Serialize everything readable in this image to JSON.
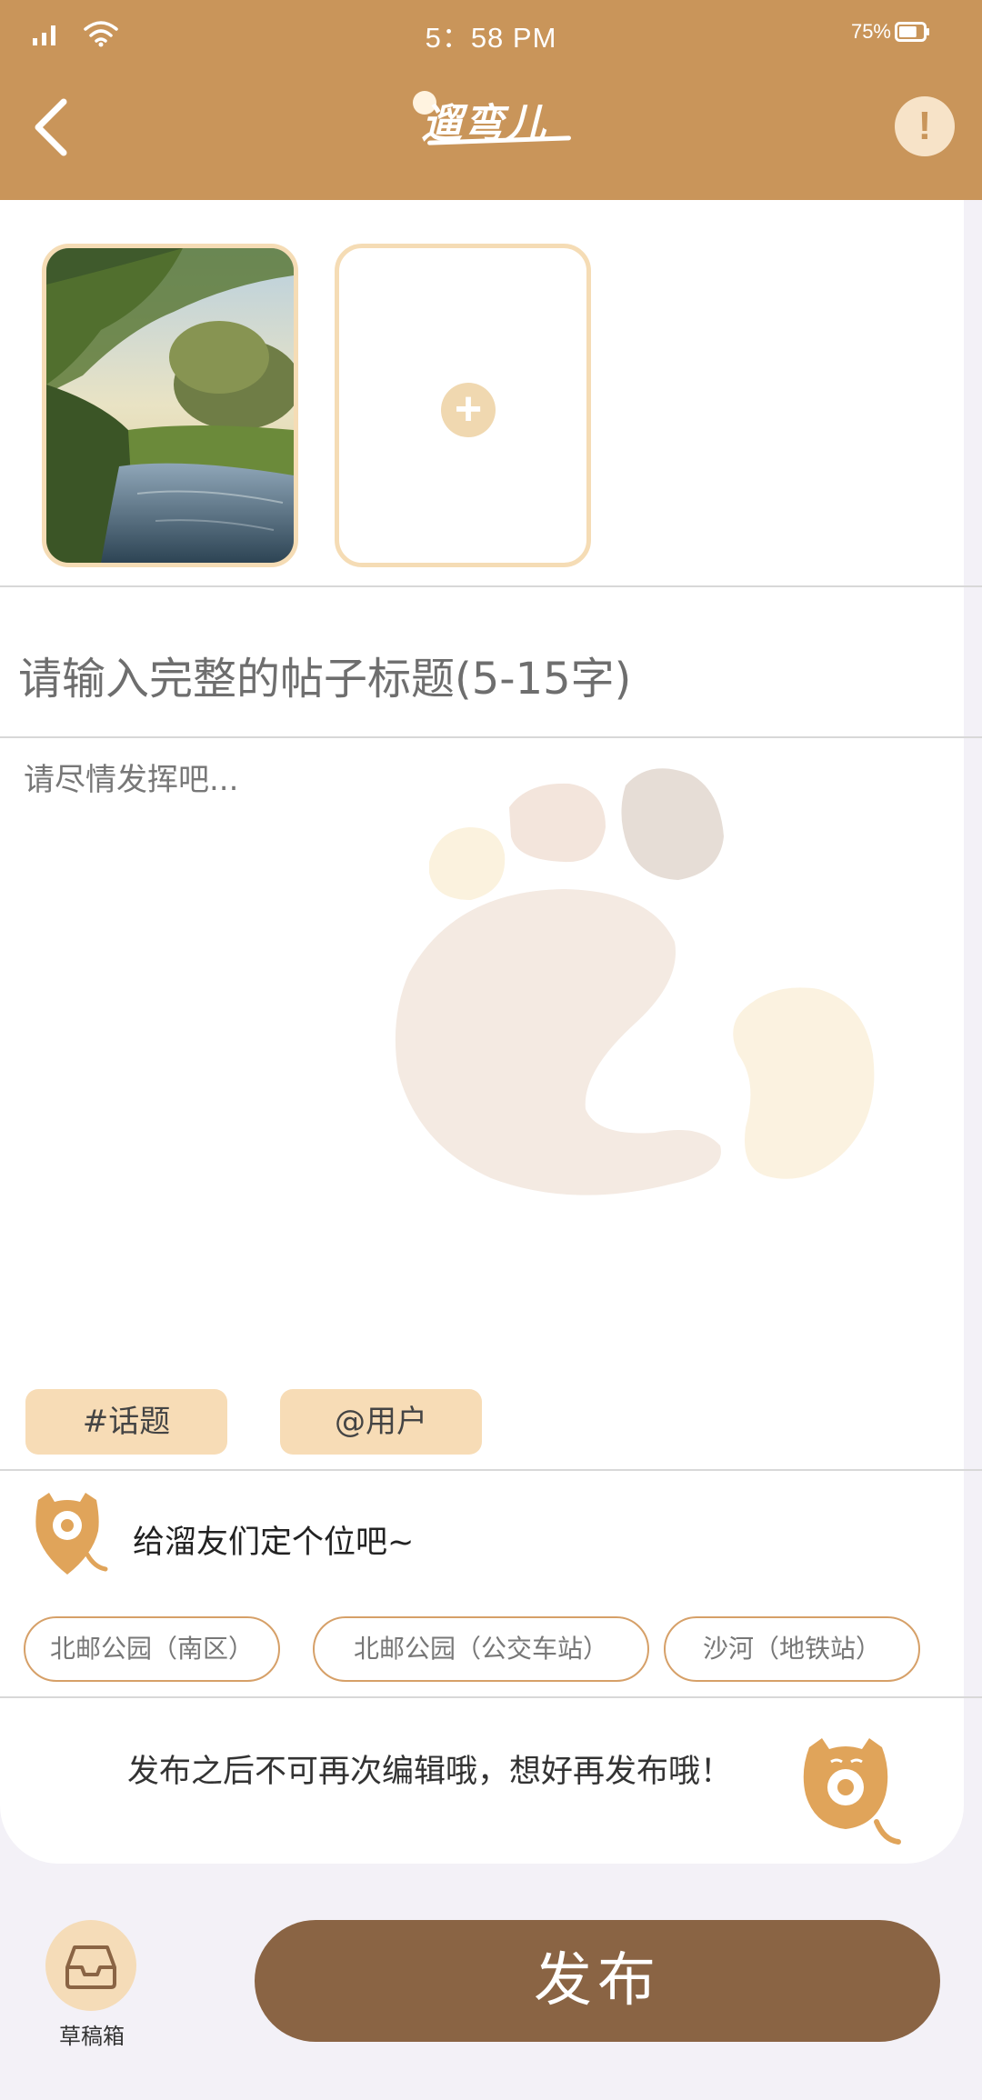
{
  "status_bar": {
    "time": "5：58 PM",
    "battery": "75%",
    "battery_level": 0.75
  },
  "header": {
    "logo_text": "遛弯儿",
    "info_symbol": "!",
    "background_color": "#c9955a"
  },
  "photos": {
    "add_symbol": "+"
  },
  "post": {
    "title_placeholder": "请输入完整的帖子标题(5-15字)",
    "body_placeholder": "请尽情发挥吧..."
  },
  "tags": {
    "topic": "#话题",
    "mention": "@用户"
  },
  "location": {
    "prompt": "给溜友们定个位吧~",
    "suggestions": [
      "北邮公园（南区）",
      "北邮公园（公交车站）",
      "沙河（地铁站）"
    ]
  },
  "notice": "发布之后不可再次编辑哦，想好再发布哦！",
  "footer": {
    "drafts_label": "草稿箱",
    "publish_label": "发布",
    "publish_color": "#8a6444"
  }
}
